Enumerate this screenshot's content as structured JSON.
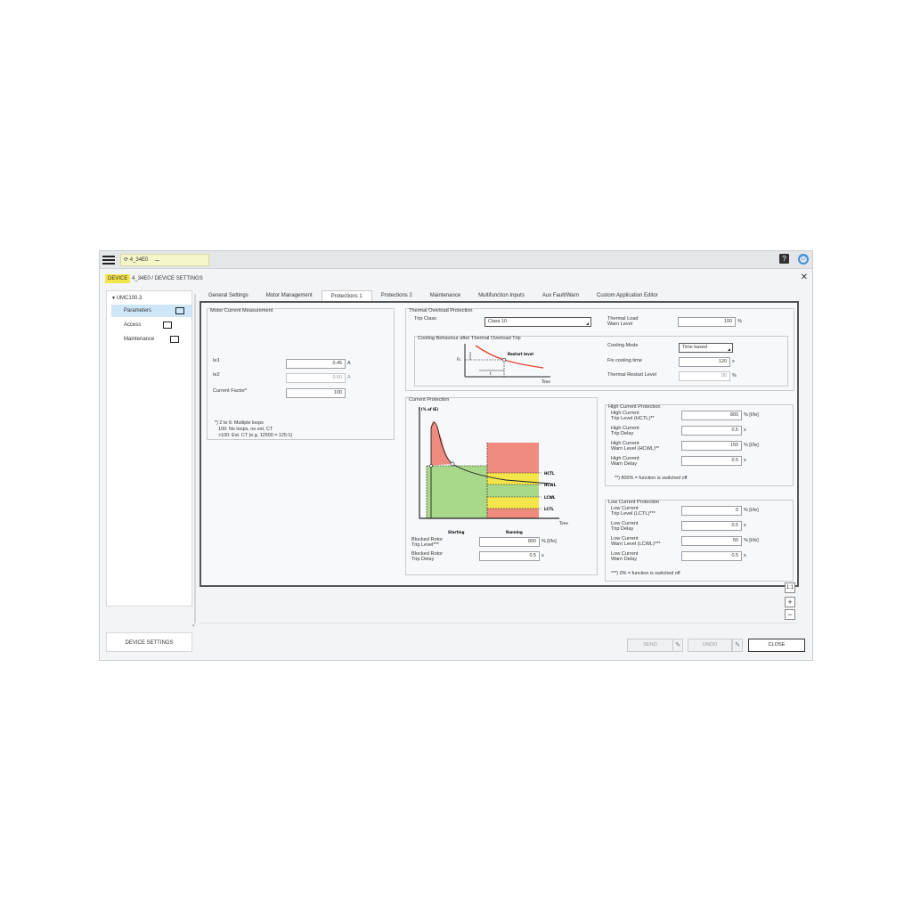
{
  "topbar": {
    "device_name": "4_34E0",
    "device_dots": "...",
    "help_symbol": "?",
    "power_symbol": "⏻"
  },
  "breadcrumb": {
    "tag": "DEVICE",
    "path": "4_34E0 / DEVICE SETTINGS",
    "close_symbol": "✕"
  },
  "sidebar": {
    "root": "UMC100.3",
    "items": [
      {
        "label": "Parameters"
      },
      {
        "label": "Access"
      },
      {
        "label": "Maintenance"
      }
    ],
    "bottom_tab": "DEVICE SETTINGS"
  },
  "tabs": [
    "General Settings",
    "Motor Management",
    "Protections 1",
    "Protections 2",
    "Maintenance",
    "Multifunction Inputs",
    "Aux Fault/Warn",
    "Custom Application Editor"
  ],
  "motor_current": {
    "title": "Motor Current Measurement",
    "ie1_label": "Ie1",
    "ie1_value": "0.45",
    "ie1_unit": "A",
    "ie2_label": "Ie2",
    "ie2_value": "0.50",
    "ie2_unit": "A",
    "factor_label": "Current Factor*",
    "factor_value": "100",
    "note": [
      "*) 2 to 6: Multiple loops",
      "100: No loops, no ext. CT",
      ">100: Ext. CT (e.g. 12500 = 125:1)"
    ]
  },
  "thermal": {
    "title": "Thermal Overload Protection",
    "trip_class_label": "Trip Class",
    "trip_class_value": "Class 10",
    "warn_label": [
      "Thermal Load",
      "Warn Level"
    ],
    "warn_value": "100",
    "warn_unit": "%",
    "cooling_title": "Cooling Behaviour after Thermal Overload Trip",
    "diagram_restart": "Restart level",
    "diagram_time": "Time",
    "diagram_fc": "Fc",
    "diagram_t": "t",
    "cooling_mode_label": "Cooling Mode",
    "cooling_mode_value": "Time based",
    "fix_cooling_label": "Fix cooling time",
    "fix_cooling_value": "120",
    "fix_cooling_unit": "s",
    "restart_label": "Thermal Restart Level",
    "restart_value": "30",
    "restart_unit": "%"
  },
  "current_protection": {
    "title": "Current Protection",
    "y_label": "I (% of IE)",
    "x_label": "Time",
    "starting": "Starting",
    "running": "Running",
    "levels": [
      "HCTL",
      "HCWL",
      "LCWL",
      "LCTL"
    ],
    "blocked_trip_label": [
      "Blocked Rotor",
      "Trip Level***"
    ],
    "blocked_trip_value": "800",
    "blocked_trip_unit": "% [I/Ie]",
    "blocked_delay_label": [
      "Blocked Rotor",
      "Trip Delay"
    ],
    "blocked_delay_value": "0.5",
    "blocked_delay_unit": "s"
  },
  "high_current": {
    "title": "High Current Protection",
    "rows": [
      {
        "label": [
          "High Current",
          "Trip Level (HCTL)**"
        ],
        "value": "800",
        "unit": "% [I/Ie]"
      },
      {
        "label": [
          "High Current",
          "Trip Delay"
        ],
        "value": "0.5",
        "unit": "s"
      },
      {
        "label": [
          "High Current",
          "Warn Level (HCWL)**"
        ],
        "value": "150",
        "unit": "% [I/Ie]"
      },
      {
        "label": [
          "High Current",
          "Warn Delay"
        ],
        "value": "0.5",
        "unit": "s"
      }
    ],
    "note": "**) 800% = function is switched off"
  },
  "low_current": {
    "title": "Low Current Protection",
    "rows": [
      {
        "label": [
          "Low Current",
          "Trip Level (LCTL)***"
        ],
        "value": "0",
        "unit": "% [I/Ie]"
      },
      {
        "label": [
          "Low Current",
          "Trip Delay"
        ],
        "value": "0.5",
        "unit": "s"
      },
      {
        "label": [
          "Low Current",
          "Warn Level (LCWL)***"
        ],
        "value": "50",
        "unit": "% [I/Ie]"
      },
      {
        "label": [
          "Low Current",
          "Warn Delay"
        ],
        "value": "0.5",
        "unit": "s"
      }
    ],
    "note": "***) 0% = function is switched off"
  },
  "zoom": {
    "fit": "1:1",
    "plus": "+",
    "minus": "−"
  },
  "buttons": {
    "send": "SEND",
    "undo": "UNDO",
    "close": "CLOSE",
    "pencil": "✎"
  },
  "colors": {
    "red_zone": "#f08b80",
    "green_zone": "#a8d98b",
    "yellow_zone": "#f3e54a",
    "accent_blue": "#3d8fd6",
    "selected": "#cde6f8"
  }
}
